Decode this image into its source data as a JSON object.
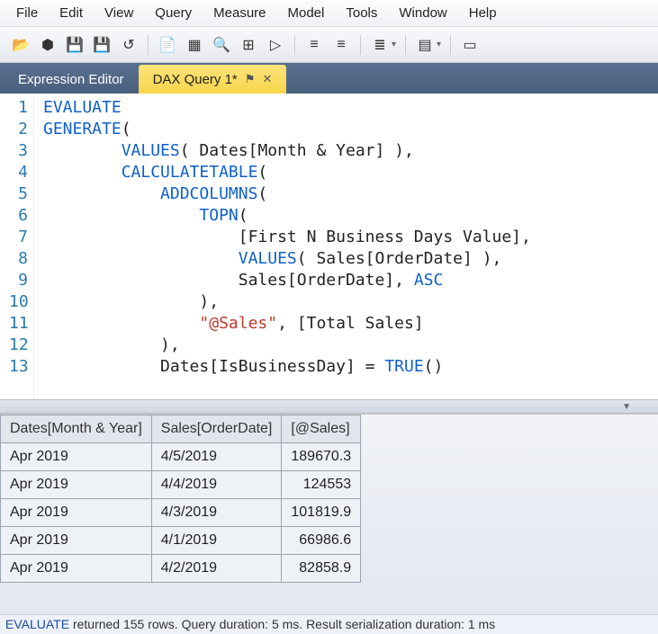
{
  "menu": [
    "File",
    "Edit",
    "View",
    "Query",
    "Measure",
    "Model",
    "Tools",
    "Window",
    "Help"
  ],
  "tabs": {
    "inactive": "Expression Editor",
    "active": "DAX Query 1*"
  },
  "code": {
    "lines": [
      {
        "n": 1,
        "html": "<span class='kw'>EVALUATE</span>"
      },
      {
        "n": 2,
        "html": "<span class='kw'>GENERATE</span>("
      },
      {
        "n": 3,
        "html": "        <span class='fn'>VALUES</span>( <span class='ref'>Dates[Month &amp; Year]</span> ),"
      },
      {
        "n": 4,
        "html": "        <span class='fn'>CALCULATETABLE</span>("
      },
      {
        "n": 5,
        "html": "            <span class='fn'>ADDCOLUMNS</span>("
      },
      {
        "n": 6,
        "html": "                <span class='fn'>TOPN</span>("
      },
      {
        "n": 7,
        "html": "                    [First N Business Days Value],"
      },
      {
        "n": 8,
        "html": "                    <span class='fn'>VALUES</span>( <span class='ref'>Sales[OrderDate]</span> ),"
      },
      {
        "n": 9,
        "html": "                    <span class='ref'>Sales[OrderDate]</span>, <span class='kw'>ASC</span>"
      },
      {
        "n": 10,
        "html": "                ),"
      },
      {
        "n": 11,
        "html": "                <span class='str'>\"@Sales\"</span>, [Total Sales]"
      },
      {
        "n": 12,
        "html": "            ),"
      },
      {
        "n": 13,
        "html": "            <span class='ref'>Dates[IsBusinessDay]</span> = <span class='fn'>TRUE</span>()"
      }
    ]
  },
  "results": {
    "columns": [
      "Dates[Month & Year]",
      "Sales[OrderDate]",
      "[@Sales]"
    ],
    "rows": [
      [
        "Apr 2019",
        "4/5/2019",
        "189670.3"
      ],
      [
        "Apr 2019",
        "4/4/2019",
        "124553"
      ],
      [
        "Apr 2019",
        "4/3/2019",
        "101819.9"
      ],
      [
        "Apr 2019",
        "4/1/2019",
        "66986.6"
      ],
      [
        "Apr 2019",
        "4/2/2019",
        "82858.9"
      ]
    ]
  },
  "status": {
    "keyword": "EVALUATE",
    "rest": " returned 155 rows. Query duration: 5 ms. Result serialization duration: 1 ms"
  },
  "toolbar_icons": [
    "open",
    "cube",
    "save",
    "save-all",
    "undo",
    "sep",
    "doc",
    "form",
    "find",
    "tree",
    "run",
    "sep",
    "indent-left",
    "indent-right",
    "sep",
    "format",
    "drop",
    "sep",
    "align",
    "drop",
    "sep",
    "panel"
  ]
}
